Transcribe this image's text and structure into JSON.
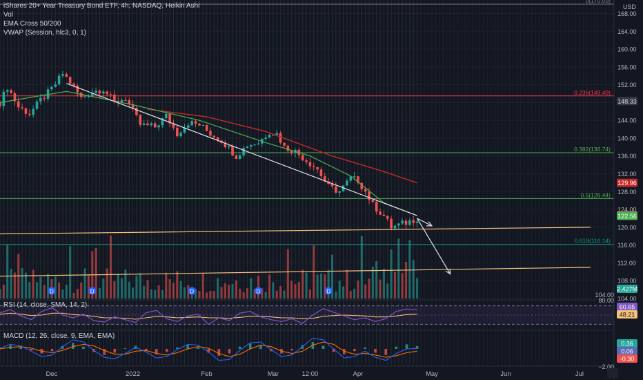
{
  "header": {
    "title": "iShares 20+ Year Treasury Bond ETF, 4h, NASDAQ, Heikin Ashi",
    "vol": "Vol",
    "ema": "EMA Cross 50/200",
    "vwap": "VWAP (Session, hlc3, 0, 1)",
    "rsi": "RSI (14, close, SMA, 14, 2)",
    "macd": "MACD (12, 26, close, 9, EMA, EMA)"
  },
  "colors": {
    "background": "#131722",
    "up": "#26a69a",
    "down": "#ef5350",
    "ema_fast": "#4caf50",
    "ema_slow": "#c62828",
    "fib_0": "#787b86",
    "fib_236": "#f23645",
    "fib_382": "#4caf50",
    "fib_5": "#4caf50",
    "fib_618": "#089981",
    "support": "#f5c07a",
    "trend": "#e0e3eb"
  },
  "chart_data": [
    {
      "type": "candlestick",
      "currency": "USD",
      "ylim": [
        104,
        170.09
      ],
      "y_ticks": [
        168.0,
        164.0,
        160.0,
        156.0,
        152.0,
        148.0,
        144.0,
        140.0,
        136.0,
        132.0,
        128.0,
        124.0,
        120.0,
        116.0,
        112.0,
        108.0,
        104.0
      ],
      "x_ticks": [
        "Dec",
        "2022",
        "Feb",
        "Mar",
        "12:00",
        "Apr",
        "May",
        "Jun",
        "Jul"
      ],
      "x_tick_index": [
        14,
        36,
        56,
        74,
        84,
        97,
        117,
        137,
        157
      ],
      "price_path": [
        [
          0,
          148.0
        ],
        [
          2,
          151.5
        ],
        [
          5,
          147.0
        ],
        [
          8,
          145.5
        ],
        [
          11,
          148.5
        ],
        [
          14,
          151.0
        ],
        [
          17,
          154.5
        ],
        [
          19,
          152.5
        ],
        [
          22,
          149.0
        ],
        [
          25,
          150.5
        ],
        [
          28,
          151.0
        ],
        [
          31,
          148.0
        ],
        [
          34,
          149.0
        ],
        [
          36,
          146.0
        ],
        [
          38,
          143.0
        ],
        [
          42,
          142.5
        ],
        [
          45,
          145.0
        ],
        [
          48,
          141.0
        ],
        [
          51,
          143.5
        ],
        [
          54,
          143.0
        ],
        [
          57,
          141.0
        ],
        [
          60,
          139.5
        ],
        [
          64,
          136.0
        ],
        [
          67,
          138.5
        ],
        [
          70,
          139.0
        ],
        [
          73,
          141.5
        ],
        [
          75,
          141.0
        ],
        [
          77,
          138.0
        ],
        [
          80,
          137.0
        ],
        [
          83,
          135.0
        ],
        [
          86,
          133.0
        ],
        [
          89,
          129.0
        ],
        [
          92,
          128.0
        ],
        [
          95,
          131.0
        ],
        [
          97,
          130.5
        ],
        [
          99,
          128.0
        ],
        [
          101,
          125.0
        ],
        [
          104,
          122.5
        ],
        [
          106,
          120.0
        ],
        [
          108,
          120.5
        ],
        [
          110,
          121.0
        ],
        [
          113,
          122.0
        ]
      ],
      "ema_50": [
        [
          0,
          148.0
        ],
        [
          18,
          150.5
        ],
        [
          36,
          147.5
        ],
        [
          54,
          144.0
        ],
        [
          72,
          139.0
        ],
        [
          84,
          136.0
        ],
        [
          95,
          131.5
        ],
        [
          104,
          125.5
        ],
        [
          113,
          122.6
        ]
      ],
      "ema_200": [
        [
          40,
          146.5
        ],
        [
          56,
          144.8
        ],
        [
          72,
          141.5
        ],
        [
          90,
          136.0
        ],
        [
          104,
          132.5
        ],
        [
          113,
          129.96
        ]
      ],
      "fib_levels": [
        {
          "label": "0(170.09)",
          "value": 170.09
        },
        {
          "label": "0.236(149.49)",
          "value": 149.49
        },
        {
          "label": "0.382(136.74)",
          "value": 136.74
        },
        {
          "label": "0.5(126.44)",
          "value": 126.44
        },
        {
          "label": "0.618(116.14)",
          "value": 116.14
        }
      ],
      "price_labels": [
        {
          "text": "148.33",
          "value": 148.33,
          "bg": "#363a45",
          "fg": "#d1d4dc"
        },
        {
          "text": "129.96",
          "value": 129.96,
          "bg": "#c62828",
          "fg": "#ffffff"
        },
        {
          "text": "122.67",
          "value": 122.67,
          "bg": "#ef5350",
          "fg": "#ffffff"
        },
        {
          "text": "122.61",
          "value": 122.61,
          "bg": "#ef5350",
          "fg": "#ffffff"
        },
        {
          "text": "122.56",
          "value": 122.56,
          "bg": "#4caf50",
          "fg": "#ffffff"
        }
      ],
      "dividends_at": [
        14,
        25,
        52,
        70,
        89
      ],
      "dividend_symbol": "D",
      "volume_label": "2.427M",
      "drawings": {
        "channel_upper": [
          [
            18,
            152.3
          ],
          [
            113,
            122.6
          ]
        ],
        "support": [
          [
            0,
            118.5
          ],
          [
            160,
            120.0
          ]
        ],
        "support_low": [
          [
            0,
            109.0
          ],
          [
            160,
            111.0
          ]
        ],
        "arrow_right": [
          [
            113,
            122.0
          ],
          [
            117,
            120.3
          ]
        ],
        "arrow_down": [
          [
            113,
            122.0
          ],
          [
            122,
            109.5
          ]
        ]
      }
    },
    {
      "type": "line",
      "name": "RSI",
      "ylim": [
        20,
        80
      ],
      "bands": [
        70,
        30
      ],
      "mid": 50,
      "values_rsi": [
        55,
        62,
        48,
        40,
        58,
        66,
        50,
        44,
        52,
        38,
        35,
        46,
        40,
        34,
        55,
        60,
        42,
        36,
        48,
        52,
        30,
        44,
        38,
        54,
        58,
        46,
        40,
        36,
        42,
        32,
        50,
        64,
        56,
        48,
        40,
        44,
        36,
        42,
        58,
        63,
        61
      ],
      "values_ma": [
        52,
        54,
        52,
        49,
        50,
        54,
        54,
        51,
        50,
        47,
        44,
        44,
        43,
        41,
        44,
        47,
        46,
        44,
        45,
        46,
        44,
        44,
        43,
        45,
        47,
        47,
        46,
        44,
        44,
        42,
        43,
        47,
        49,
        50,
        49,
        48,
        46,
        46,
        48,
        51,
        52
      ],
      "labels": [
        {
          "text": "60.65",
          "bg": "#7e57c2",
          "fg": "#ffffff"
        },
        {
          "text": "48.21",
          "bg": "#f5c07a",
          "fg": "#131722"
        }
      ]
    },
    {
      "type": "bar",
      "name": "MACD",
      "histogram": [
        0.2,
        0.5,
        0.3,
        -0.2,
        -0.6,
        -0.3,
        0.4,
        0.8,
        0.3,
        -0.4,
        -0.8,
        -0.5,
        0.1,
        0.4,
        -0.3,
        -0.7,
        -0.4,
        0.2,
        0.5,
        0.2,
        -0.5,
        -0.9,
        -0.6,
        0.3,
        0.7,
        0.4,
        -0.3,
        -0.6,
        -0.2,
        0.5,
        0.9,
        0.4,
        -0.4,
        -0.7,
        -0.3,
        0.2,
        -0.5,
        -0.8,
        0.3,
        0.6,
        0.36
      ],
      "macd_line": [
        0.1,
        0.6,
        0.4,
        -0.3,
        -1.0,
        -0.8,
        0.3,
        1.2,
        0.9,
        -0.2,
        -1.1,
        -1.3,
        -0.6,
        0.2,
        -0.4,
        -1.2,
        -1.0,
        -0.1,
        0.6,
        0.5,
        -0.4,
        -1.5,
        -1.4,
        -0.2,
        0.8,
        0.9,
        -0.1,
        -1.0,
        -0.8,
        0.3,
        1.4,
        1.2,
        0.0,
        -1.2,
        -1.0,
        -0.3,
        -1.1,
        -1.5,
        -0.6,
        0.0,
        0.06
      ],
      "signal_line": [
        0.0,
        0.2,
        0.3,
        0.1,
        -0.3,
        -0.5,
        -0.2,
        0.3,
        0.6,
        0.4,
        -0.2,
        -0.7,
        -0.7,
        -0.3,
        -0.2,
        -0.6,
        -0.8,
        -0.5,
        0.0,
        0.3,
        0.1,
        -0.6,
        -1.0,
        -0.7,
        0.0,
        0.5,
        0.3,
        -0.3,
        -0.6,
        -0.3,
        0.5,
        0.9,
        0.6,
        -0.3,
        -0.7,
        -0.6,
        -0.8,
        -1.1,
        -0.9,
        -0.5,
        -0.3
      ],
      "labels": [
        {
          "text": "0.36",
          "bg": "#26a69a",
          "fg": "#ffffff"
        },
        {
          "text": "0.06",
          "bg": "#5b6bb5",
          "fg": "#ffffff"
        },
        {
          "text": "-0.30",
          "bg": "#ef5350",
          "fg": "#ffffff"
        }
      ],
      "left_labels": [
        "80.00",
        "−2.00"
      ]
    }
  ]
}
